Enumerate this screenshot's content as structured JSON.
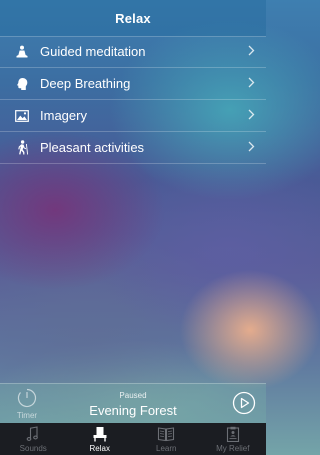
{
  "nav": {
    "title": "Relax"
  },
  "menu": [
    {
      "label": "Guided meditation",
      "icon": "meditation-icon"
    },
    {
      "label": "Deep Breathing",
      "icon": "head-breathing-icon"
    },
    {
      "label": "Imagery",
      "icon": "picture-icon"
    },
    {
      "label": "Pleasant activities",
      "icon": "hiker-icon"
    }
  ],
  "player": {
    "timer_label": "Timer",
    "status": "Paused",
    "track": "Evening Forest"
  },
  "tabs": [
    {
      "label": "Sounds",
      "icon": "music-note-icon",
      "active": false
    },
    {
      "label": "Relax",
      "icon": "lounge-chair-icon",
      "active": true
    },
    {
      "label": "Learn",
      "icon": "book-icon",
      "active": false
    },
    {
      "label": "My Relief",
      "icon": "clipboard-icon",
      "active": false
    }
  ],
  "colors": {
    "tab_bar": "#1b1d22",
    "active_tab": "#ffffff",
    "inactive_tab": "#6c6f75"
  }
}
